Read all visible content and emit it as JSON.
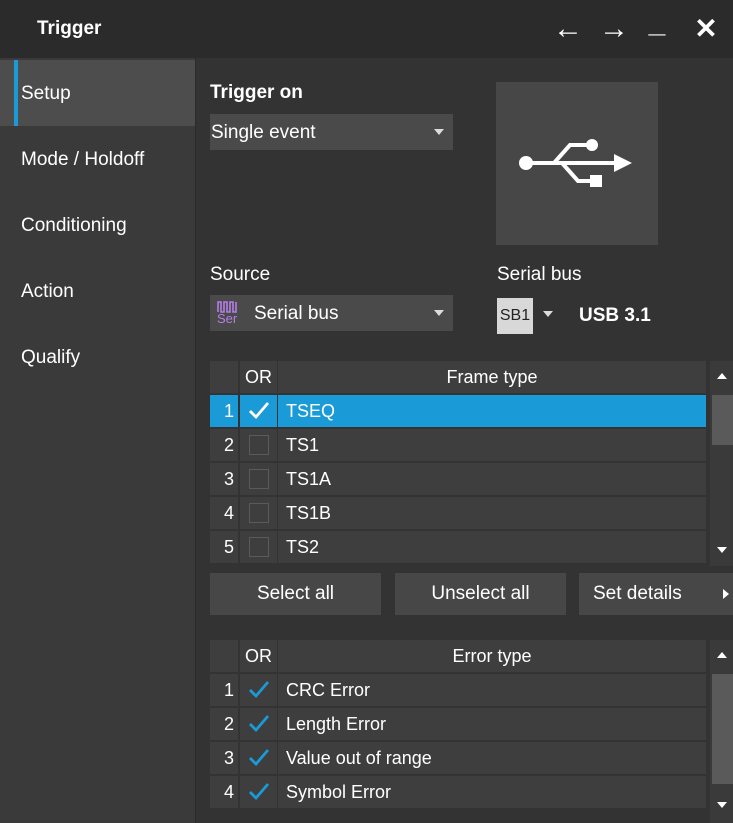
{
  "window": {
    "title": "Trigger",
    "controls": [
      "←",
      "→",
      "_",
      "✕"
    ]
  },
  "sidebar": {
    "items": [
      {
        "label": "Setup",
        "active": true
      },
      {
        "label": "Mode / Holdoff",
        "active": false
      },
      {
        "label": "Conditioning",
        "active": false
      },
      {
        "label": "Action",
        "active": false
      },
      {
        "label": "Qualify",
        "active": false
      }
    ]
  },
  "setup": {
    "trigger_on_label": "Trigger on",
    "trigger_on_value": "Single event",
    "protocol_icon": "usb-icon",
    "source_label": "Source",
    "source_icon_text": "Ser",
    "source_value": "Serial bus",
    "serial_bus_label": "Serial bus",
    "serial_bus_badge": "SB1",
    "serial_bus_protocol": "USB 3.1"
  },
  "frame_table": {
    "headers": [
      "OR",
      "Frame type"
    ],
    "rows": [
      {
        "num": "1",
        "checked": true,
        "type": "TSEQ",
        "selected": true
      },
      {
        "num": "2",
        "checked": false,
        "type": "TS1",
        "selected": false
      },
      {
        "num": "3",
        "checked": false,
        "type": "TS1A",
        "selected": false
      },
      {
        "num": "4",
        "checked": false,
        "type": "TS1B",
        "selected": false
      },
      {
        "num": "5",
        "checked": false,
        "type": "TS2",
        "selected": false
      }
    ]
  },
  "buttons": {
    "select_all": "Select all",
    "unselect_all": "Unselect all",
    "set_details": "Set details"
  },
  "error_table": {
    "headers": [
      "OR",
      "Error type"
    ],
    "rows": [
      {
        "num": "1",
        "checked": true,
        "type": "CRC Error"
      },
      {
        "num": "2",
        "checked": true,
        "type": "Length Error"
      },
      {
        "num": "3",
        "checked": true,
        "type": "Value out of range"
      },
      {
        "num": "4",
        "checked": true,
        "type": "Symbol Error"
      }
    ]
  },
  "colors": {
    "accent": "#1a9bd7",
    "background": "#2b2b2b",
    "panel": "#333333",
    "sidebar": "#3a3a3a"
  }
}
